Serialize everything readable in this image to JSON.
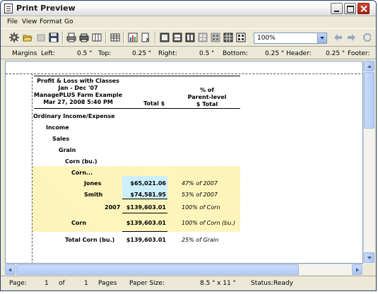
{
  "window": {
    "title": "Print Preview"
  },
  "menu": [
    "File",
    "View",
    "Format",
    "Go"
  ],
  "toolbar": {
    "icons": [
      "gear-icon",
      "open-folder-icon",
      "disabled-icon",
      "save-icon",
      "print-icon",
      "printer-icon",
      "columns-icon",
      "table-icon",
      "chart-icon",
      "page-setup-icon",
      "single-page-icon",
      "fit-page-icon",
      "two-page-icon",
      "four-page-icon",
      "multi-page-icon",
      "grid-page-icon",
      "nine-page-icon"
    ],
    "zoom": "100%",
    "nav": [
      "back-arrow-icon",
      "forward-arrow-icon"
    ]
  },
  "margins": {
    "label": "Margins",
    "fields": [
      {
        "name": "Left:",
        "value": "0.5 \""
      },
      {
        "name": "Top:",
        "value": "0.25 \""
      },
      {
        "name": "Right:",
        "value": "0.5 \""
      },
      {
        "name": "Bottom:",
        "value": "0.25 \""
      },
      {
        "name": "Header:",
        "value": "0.25 \""
      },
      {
        "name": "Footer:",
        "value": ""
      }
    ]
  },
  "report": {
    "title": "Profit & Loss with Classes",
    "period": "Jan - Dec '07",
    "company": "ManagePLUS Farm Example",
    "timestamp": "Mar 27, 2008  5:40 PM",
    "col_total": "Total $",
    "col_pct_1": "% of",
    "col_pct_2": "Parent-level",
    "col_pct_3": "$ Total",
    "rows": [
      {
        "label": "Ordinary Income/Expense",
        "total": "",
        "pct": ""
      },
      {
        "label": "Income",
        "total": "",
        "pct": ""
      },
      {
        "label": "Sales",
        "total": "",
        "pct": ""
      },
      {
        "label": "Grain",
        "total": "",
        "pct": ""
      },
      {
        "label": "Corn (bu.)",
        "total": "",
        "pct": ""
      },
      {
        "label": "Corn...",
        "total": "",
        "pct": ""
      },
      {
        "label": "Jones",
        "total": "$65,021.06",
        "pct": "47% of 2007"
      },
      {
        "label": "Smith",
        "total": "$74,581.95",
        "pct": "53% of 2007"
      },
      {
        "label": "2007",
        "total": "$139,603.01",
        "pct": "100% of Corn"
      },
      {
        "label": "Corn",
        "total": "$139,603.01",
        "pct": "100% of Corn (bu.)"
      },
      {
        "label": "Total Corn (bu.)",
        "total": "$139,603.01",
        "pct": "25% of Grain"
      }
    ]
  },
  "status": {
    "page_label": "Page:",
    "page": "1",
    "of_label": "of",
    "pages": "1",
    "pages_label": "Pages",
    "paper_label": "Paper Size:",
    "paper": "8.5 \" x 11 \"",
    "status_label": "Status:",
    "status": "Ready"
  },
  "colors": {
    "highlight_yellow": "#fff8c4",
    "highlight_blue": "#ccf0fb",
    "chrome": "#ece9d8"
  }
}
